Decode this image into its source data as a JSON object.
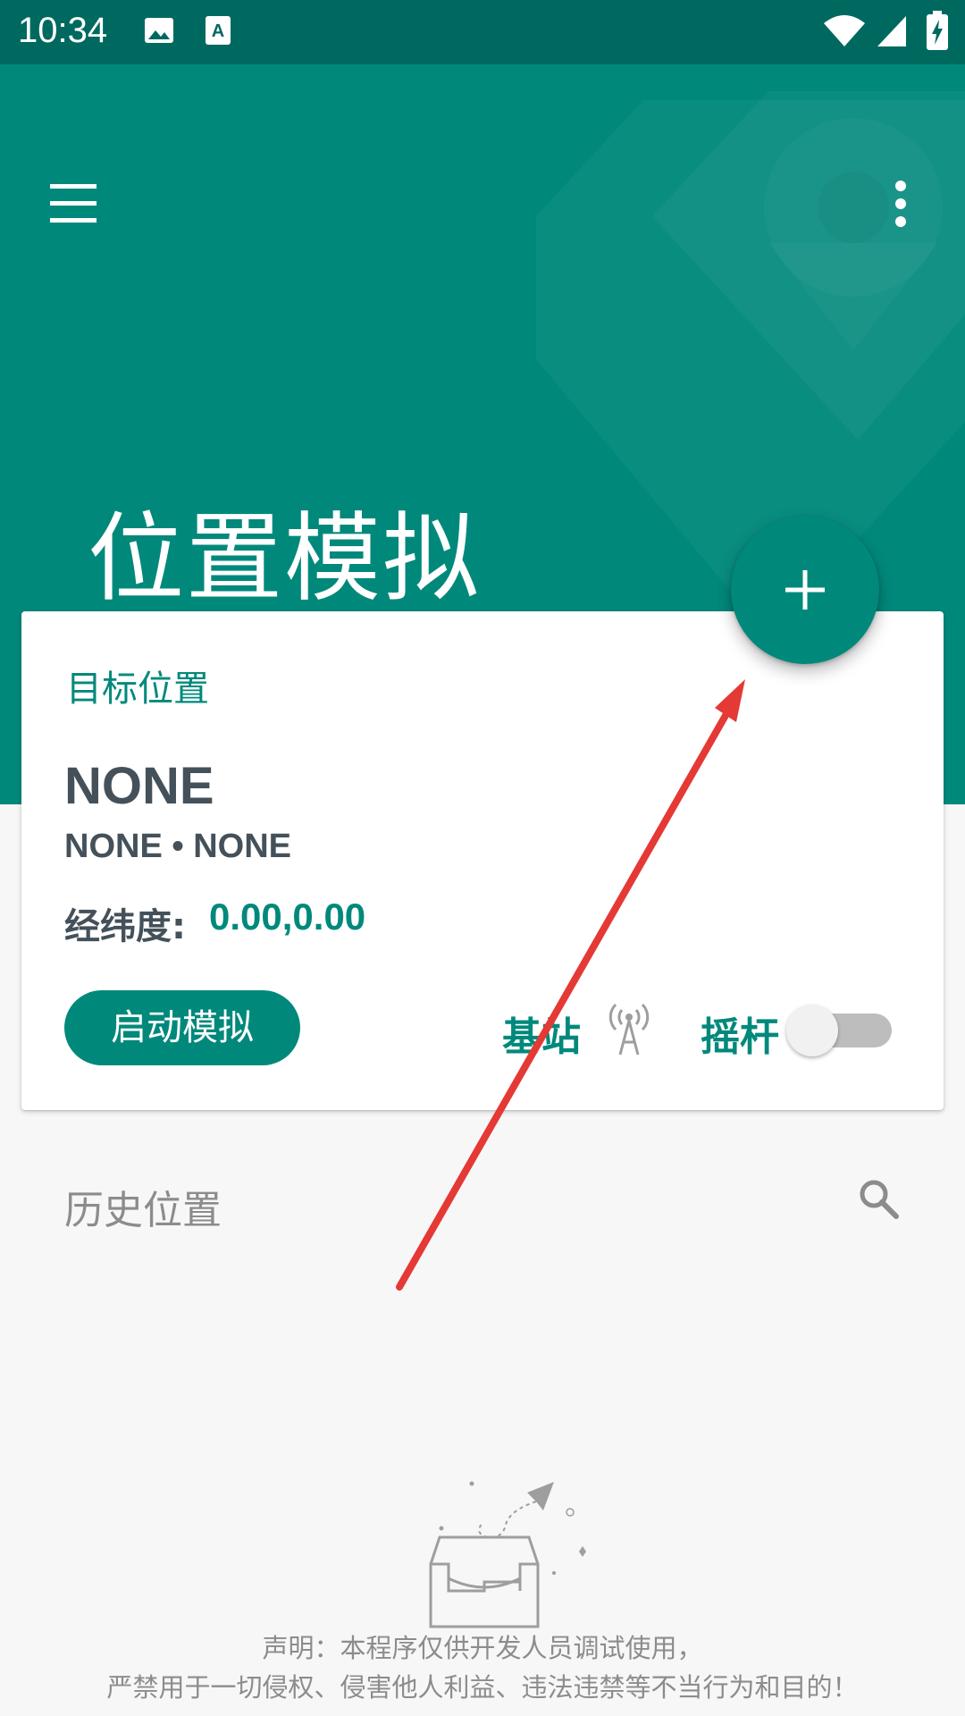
{
  "status_bar": {
    "time": "10:34",
    "icons": [
      "image-icon",
      "text-icon",
      "wifi-icon",
      "signal-icon",
      "battery-charging-icon"
    ]
  },
  "toolbar": {
    "menu_icon": "menu-icon",
    "more_icon": "more-vert-icon"
  },
  "header": {
    "title": "位置模拟",
    "color": "#00897b"
  },
  "fab": {
    "icon": "plus-icon"
  },
  "target_card": {
    "title": "目标位置",
    "location_name": "NONE",
    "location_sub": "NONE • NONE",
    "coord_label": "经纬度:",
    "coord_value": "0.00,0.00",
    "start_button": "启动模拟",
    "base_station_label": "基站",
    "base_station_icon": "cell-tower-icon",
    "joystick_label": "摇杆",
    "joystick_enabled": false
  },
  "history": {
    "label": "历史位置",
    "search_icon": "search-icon"
  },
  "empty_state": {
    "icon": "empty-inbox-illustration"
  },
  "disclaimer": {
    "line1": "声明：本程序仅供开发人员调试使用，",
    "line2": "严禁用于一切侵权、侵害他人利益、违法违禁等不当行为和目的！"
  },
  "colors": {
    "primary": "#00897b",
    "status_bar": "#00695f",
    "annotation_arrow": "#e53935"
  }
}
